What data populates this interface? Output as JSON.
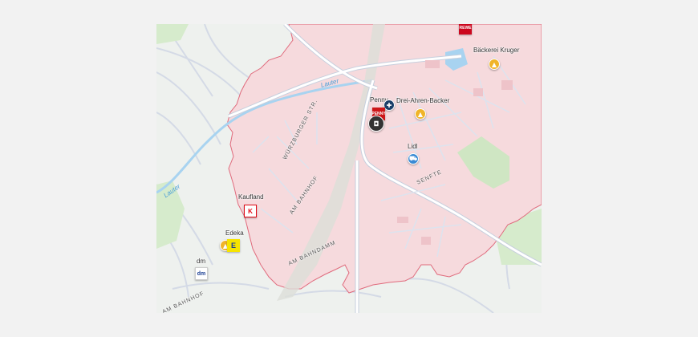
{
  "map": {
    "pois": {
      "rewe": {
        "label": "REWE",
        "color": "#cc071e"
      },
      "baeckerei_krueger": {
        "name": "Bäckerei Kruger",
        "color": "#f0b429",
        "icon": "bakery-icon"
      },
      "penny": {
        "name": "Penny",
        "badge": "PENNY",
        "color": "#cd1719"
      },
      "drei_aehren": {
        "name": "Drei-Ahren-Backer",
        "color": "#f0b429",
        "icon": "bakery-icon"
      },
      "lidl": {
        "name": "Lidl",
        "color": "#3a8ad4",
        "icon": "shopping-cart-icon"
      },
      "kaufland": {
        "name": "Kaufland",
        "badge": "K",
        "color": "#e10915"
      },
      "edeka": {
        "name": "Edeka",
        "badge": "E",
        "color": "#f6e400"
      },
      "dm": {
        "name": "dm",
        "badge": "dm",
        "color": "#1c3f94"
      }
    },
    "streets": {
      "wuerzburger": "WÜRZBURGER STR.",
      "am_bahnhof_1": "AM BAHNHOF",
      "am_bahndamm": "AM BAHNDAMM",
      "am_bahnhof_2": "AM BAHNHOF",
      "senfte": "SENFTE"
    },
    "water": {
      "lauter_1": "Lauter",
      "lauter_2": "Lauter"
    },
    "colors": {
      "background": "#eef1ee",
      "region_fill": "#f6dadd",
      "region_border": "#e06a7c",
      "road": "#ffffff",
      "road_casing": "#c7cfdd",
      "water": "#a8d3f0",
      "park": "#cfe6c3"
    }
  }
}
